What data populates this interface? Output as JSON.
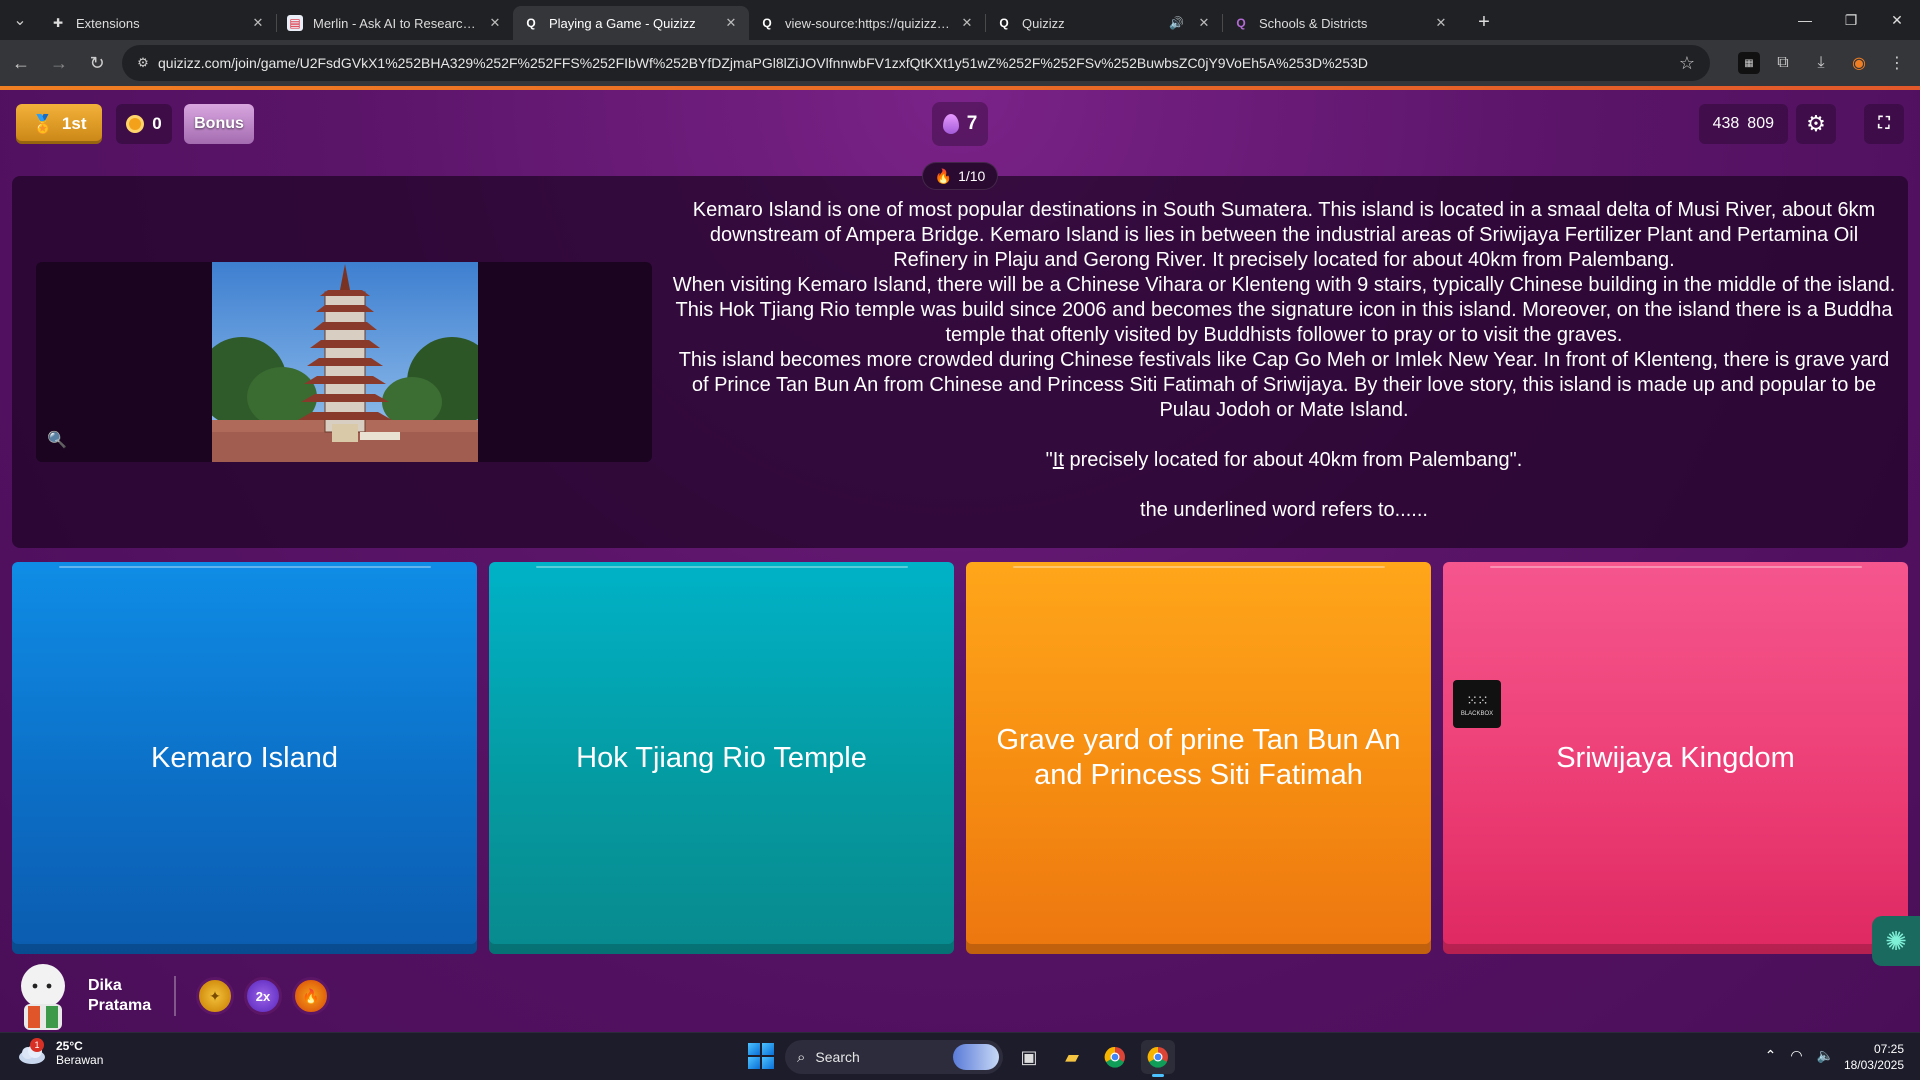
{
  "browser": {
    "tabs": [
      {
        "title": "Extensions",
        "icon": "puzzle-icon",
        "active": false
      },
      {
        "title": "Merlin - Ask AI to Research, Wr",
        "icon": "merlin-icon",
        "active": false
      },
      {
        "title": "Playing a Game - Quizizz",
        "icon": "quizizz-icon",
        "active": true
      },
      {
        "title": "view-source:https://quizizz.com",
        "icon": "quizizz-icon",
        "active": false
      },
      {
        "title": "Quizizz",
        "icon": "quizizz-icon",
        "active": false,
        "audio": true
      },
      {
        "title": "Schools & Districts",
        "icon": "quizizz-icon",
        "active": false
      }
    ],
    "url": "quizizz.com/join/game/U2FsdGVkX1%252BHA329%252F%252FFS%252FIbWf%252BYfDZjmaPGl8lZiJOVlfnnwbFV1zxfQtKXt1y51wZ%252F%252FSv%252BuwbsZC0jY9VoEh5A%253D%253D"
  },
  "game": {
    "rank": "1st",
    "coins": "0",
    "bonus_label": "Bonus",
    "streak": "7",
    "score_a": "438",
    "score_b": "809",
    "question_counter": "1/10",
    "passage": [
      "Kemaro Island is one of most popular destinations in South Sumatera. This island is located in a smaal delta of Musi River, about 6km downstream of Ampera Bridge. Kemaro Island is lies in between the industrial areas of Sriwijaya Fertilizer Plant and Pertamina Oil Refinery in Plaju and Gerong River. It precisely located for about 40km from Palembang.",
      "When visiting Kemaro Island, there will be a Chinese Vihara or Klenteng with 9 stairs, typically Chinese building in the middle of the island. This Hok Tjiang Rio temple was build since 2006 and becomes the signature icon in this island. Moreover, on the island there is a Buddha temple that oftenly visited by Buddhists follower to pray or to visit the graves.",
      "This island becomes more crowded during Chinese festivals like Cap Go Meh or Imlek New Year. In front of Klenteng, there is grave yard of Prince Tan Bun An from Chinese and Princess Siti Fatimah of Sriwijaya. By their love story, this island is made up and popular to be Pulau Jodoh or Mate Island."
    ],
    "quote_open": "\"",
    "quote_underlined": "It",
    "quote_rest": " precisely located for about 40km from Palembang\".",
    "prompt": "the underlined word refers to......",
    "options": [
      "Kemaro Island",
      "Hok Tjiang Rio Temple",
      "Grave yard of prine Tan Bun An and Princess Siti Fatimah",
      "Sriwijaya Kingdom"
    ],
    "blackbox_label": "BLACKBOX",
    "player_name": "Dika Pratama",
    "powerups": [
      "streak-saver-icon",
      "2x",
      "fire-icon"
    ]
  },
  "taskbar": {
    "temperature": "25°C",
    "weather": "Berawan",
    "weather_badge": "1",
    "search_label": "Search",
    "time": "07:25",
    "date": "18/03/2025"
  },
  "colors": {
    "option1": "#0c6dc4",
    "option2": "#05999f",
    "option3": "#f58a11",
    "option4": "#ec3c74",
    "background": "#5a1468"
  }
}
